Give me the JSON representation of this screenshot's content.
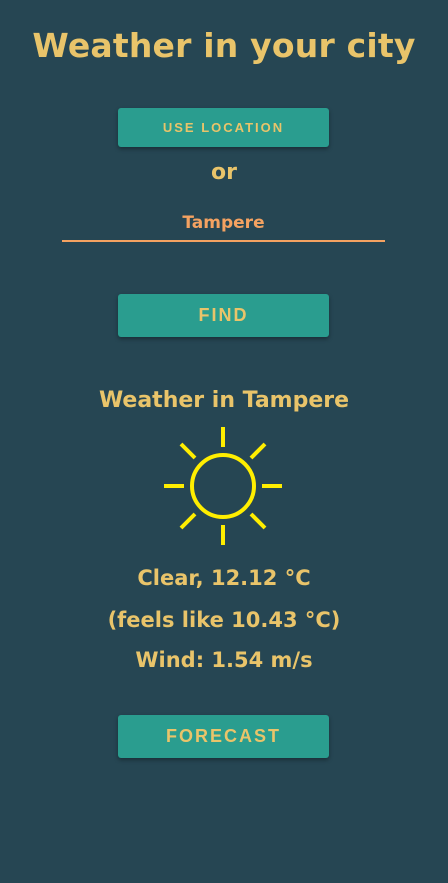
{
  "header": {
    "title": "Weather in your city"
  },
  "location": {
    "button_label": "USE LOCATION"
  },
  "separator": "or",
  "search": {
    "city_value": "Tampere",
    "find_label": "FIND"
  },
  "result": {
    "heading": "Weather in Tampere",
    "icon": "sun-icon",
    "condition_line": "Clear, 12.12 °C",
    "feels_like_line": "(feels like 10.43 °C)",
    "wind_line": "Wind: 1.54 m/s"
  },
  "forecast": {
    "button_label": "FORECAST"
  },
  "colors": {
    "background": "#264653",
    "accent": "#e9c46a",
    "button": "#2a9d8f",
    "input": "#f4a261",
    "sun": "#ffee00"
  }
}
